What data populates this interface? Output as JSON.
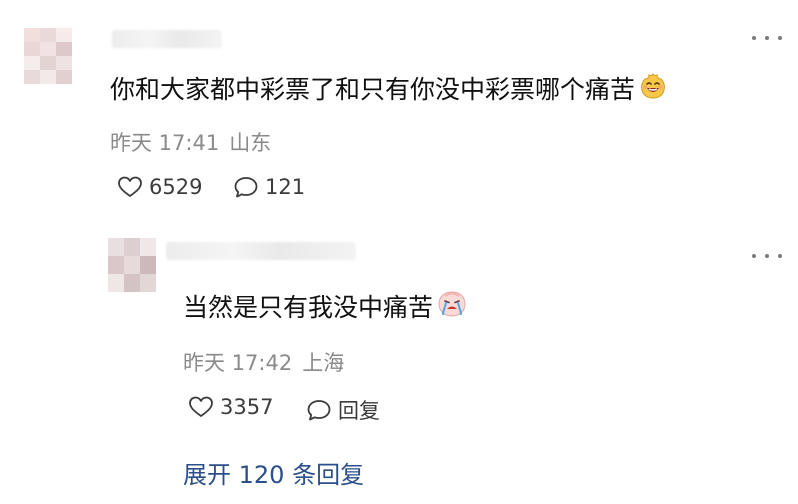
{
  "comments": [
    {
      "author": "",
      "text": "你和大家都中彩票了和只有你没中彩票哪个痛苦",
      "emoji": "grin-emoji",
      "time": "昨天 17:41",
      "location": "山东",
      "likes": "6529",
      "replies": "121"
    }
  ],
  "reply": {
    "author": "",
    "text": "当然是只有我没中痛苦",
    "emoji": "crying-emoji",
    "time": "昨天 17:42",
    "location": "上海",
    "likes": "3357",
    "reply_label": "回复"
  },
  "expand_replies_label": "展开 120 条回复",
  "icons": [
    "more-icon",
    "heart-icon",
    "comment-bubble-icon"
  ],
  "colors": {
    "text": "#111111",
    "meta": "#8a8a8a",
    "action": "#3b3b3b",
    "link": "#2b4f8a",
    "background": "#ffffff"
  }
}
